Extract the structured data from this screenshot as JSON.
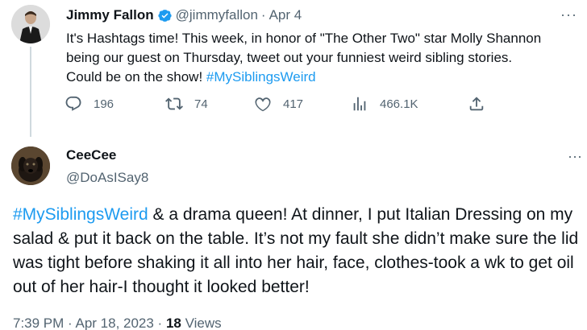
{
  "parent_tweet": {
    "author_name": "Jimmy Fallon",
    "handle": "@jimmyfallon",
    "separator": "·",
    "date": "Apr 4",
    "text_before": "It's Hashtags time! This week, in honor of \"The Other Two\" star Molly Shannon being our guest on Thursday, tweet out your funniest weird sibling stories. Could be on the show! ",
    "hashtag": "#MySiblingsWeird",
    "more_label": "···",
    "actions": {
      "replies": "196",
      "retweets": "74",
      "likes": "417",
      "views": "466.1K"
    }
  },
  "reply_tweet": {
    "author_name": "CeeCee",
    "handle": "@DoAsISay8",
    "more_label": "···",
    "hashtag": "#MySiblingsWeird",
    "text_after": " & a drama queen! At dinner, I put Italian Dressing on my salad & put it back on the table. It’s not my fault she didn’t make sure the lid was tight before shaking it all into her hair, face, clothes-took a wk to get oil out of her hair-I thought it looked better!",
    "timestamp": "7:39 PM · Apr 18, 2023 · ",
    "views_count": "18",
    "views_label": " Views"
  },
  "colors": {
    "accent": "#1d9bf0",
    "muted": "#536471",
    "text": "#0f1419",
    "line": "#cfd9de"
  }
}
